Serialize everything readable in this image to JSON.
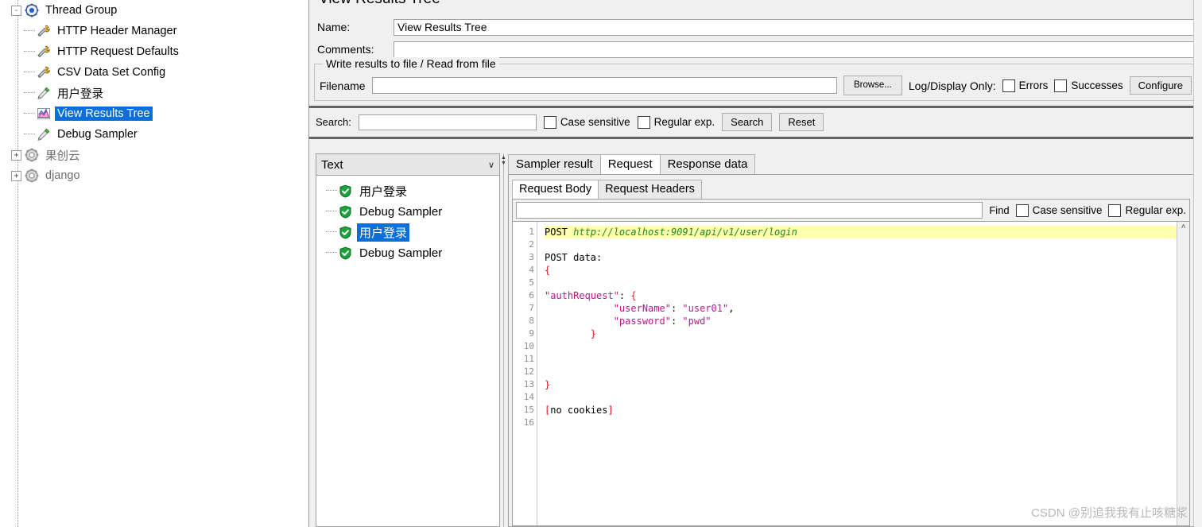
{
  "tree": {
    "items": [
      {
        "label": "Thread Group",
        "icon": "thread-group-icon",
        "depth": 0,
        "toggle": "-",
        "selected": false,
        "dim": false
      },
      {
        "label": "HTTP Header Manager",
        "icon": "config-wrench-icon",
        "depth": 1,
        "toggle": "",
        "selected": false,
        "dim": false
      },
      {
        "label": "HTTP Request Defaults",
        "icon": "config-wrench-icon",
        "depth": 1,
        "toggle": "",
        "selected": false,
        "dim": false
      },
      {
        "label": "CSV Data Set Config",
        "icon": "config-wrench-icon",
        "depth": 1,
        "toggle": "",
        "selected": false,
        "dim": false
      },
      {
        "label": "用户登录",
        "icon": "sampler-pipette-icon",
        "depth": 1,
        "toggle": "",
        "selected": false,
        "dim": false
      },
      {
        "label": "View Results Tree",
        "icon": "listener-chart-icon",
        "depth": 1,
        "toggle": "",
        "selected": true,
        "dim": false
      },
      {
        "label": "Debug Sampler",
        "icon": "sampler-pipette-icon",
        "depth": 1,
        "toggle": "",
        "selected": false,
        "dim": false
      },
      {
        "label": "果创云",
        "icon": "test-plan-gear-icon",
        "depth": 0,
        "toggle": "+",
        "selected": false,
        "dim": true
      },
      {
        "label": "django",
        "icon": "test-plan-gear-icon",
        "depth": 0,
        "toggle": "+",
        "selected": false,
        "dim": true
      }
    ]
  },
  "panel": {
    "title": "View Results Tree",
    "name_label": "Name:",
    "name_value": "View Results Tree",
    "comments_label": "Comments:",
    "comments_value": "",
    "group_legend": "Write results to file / Read from file",
    "filename_label": "Filename",
    "filename_value": "",
    "browse_label": "Browse...",
    "logdisplay_label": "Log/Display Only:",
    "errors_label": "Errors",
    "errors_checked": false,
    "successes_label": "Successes",
    "successes_checked": false,
    "configure_label": "Configure"
  },
  "search": {
    "label": "Search:",
    "value": "",
    "case_sensitive_label": "Case sensitive",
    "case_sensitive_checked": false,
    "regex_label": "Regular exp.",
    "regex_checked": false,
    "search_button": "Search",
    "reset_button": "Reset"
  },
  "results": {
    "render_selected": "Text",
    "chevron": "∨",
    "items": [
      {
        "label": "用户登录",
        "status": "success",
        "selected": false
      },
      {
        "label": "Debug Sampler",
        "status": "success",
        "selected": false
      },
      {
        "label": "用户登录",
        "status": "success",
        "selected": true
      },
      {
        "label": "Debug Sampler",
        "status": "success",
        "selected": false
      }
    ]
  },
  "tabs": {
    "main": [
      {
        "label": "Sampler result",
        "active": false
      },
      {
        "label": "Request",
        "active": true
      },
      {
        "label": "Response data",
        "active": false
      }
    ],
    "sub": [
      {
        "label": "Request Body",
        "active": true
      },
      {
        "label": "Request Headers",
        "active": false
      }
    ]
  },
  "find": {
    "value": "",
    "find_label": "Find",
    "case_sensitive_label": "Case sensitive",
    "case_sensitive_checked": false,
    "regex_label": "Regular exp.",
    "regex_checked": false
  },
  "code": {
    "scroll_up_glyph": "˄",
    "lines": [
      {
        "n": 1,
        "fold": "",
        "highlight": true,
        "parts": [
          {
            "t": "POST ",
            "c": "plain"
          },
          {
            "t": "http://localhost:9091/api/v1/user/login",
            "c": "url"
          }
        ]
      },
      {
        "n": 2,
        "fold": "",
        "highlight": false,
        "parts": []
      },
      {
        "n": 3,
        "fold": "",
        "highlight": false,
        "parts": [
          {
            "t": "POST data:",
            "c": "plain"
          }
        ]
      },
      {
        "n": 4,
        "fold": "-",
        "highlight": false,
        "parts": [
          {
            "t": "{",
            "c": "brace"
          }
        ]
      },
      {
        "n": 5,
        "fold": "",
        "highlight": false,
        "parts": []
      },
      {
        "n": 6,
        "fold": "-",
        "highlight": false,
        "parts": [
          {
            "t": "\"authRequest\"",
            "c": "str"
          },
          {
            "t": ": ",
            "c": "plain"
          },
          {
            "t": "{",
            "c": "brace"
          }
        ]
      },
      {
        "n": 7,
        "fold": "",
        "highlight": false,
        "parts": [
          {
            "t": "            ",
            "c": "plain"
          },
          {
            "t": "\"userName\"",
            "c": "str"
          },
          {
            "t": ": ",
            "c": "plain"
          },
          {
            "t": "\"user01\"",
            "c": "str"
          },
          {
            "t": ",",
            "c": "plain"
          }
        ]
      },
      {
        "n": 8,
        "fold": "",
        "highlight": false,
        "parts": [
          {
            "t": "            ",
            "c": "plain"
          },
          {
            "t": "\"password\"",
            "c": "str"
          },
          {
            "t": ": ",
            "c": "plain"
          },
          {
            "t": "\"pwd\"",
            "c": "str"
          }
        ]
      },
      {
        "n": 9,
        "fold": "",
        "highlight": false,
        "parts": [
          {
            "t": "        ",
            "c": "plain"
          },
          {
            "t": "}",
            "c": "brace"
          }
        ]
      },
      {
        "n": 10,
        "fold": "",
        "highlight": false,
        "parts": []
      },
      {
        "n": 11,
        "fold": "",
        "highlight": false,
        "parts": []
      },
      {
        "n": 12,
        "fold": "",
        "highlight": false,
        "parts": []
      },
      {
        "n": 13,
        "fold": "",
        "highlight": false,
        "parts": [
          {
            "t": "}",
            "c": "brace"
          }
        ]
      },
      {
        "n": 14,
        "fold": "",
        "highlight": false,
        "parts": []
      },
      {
        "n": 15,
        "fold": "",
        "highlight": false,
        "parts": [
          {
            "t": "[",
            "c": "brace"
          },
          {
            "t": "no cookies",
            "c": "plain"
          },
          {
            "t": "]",
            "c": "brace"
          }
        ]
      },
      {
        "n": 16,
        "fold": "",
        "highlight": false,
        "parts": []
      }
    ]
  },
  "watermark": "CSDN @别追我我有止咳糖浆",
  "colors": {
    "selection": "#0a6fd8",
    "highlight": "#ffffae",
    "url": "#1f8a1f",
    "string": "#c2138e",
    "brace": "#e01b1b",
    "panel_bg": "#f0f0f0"
  }
}
